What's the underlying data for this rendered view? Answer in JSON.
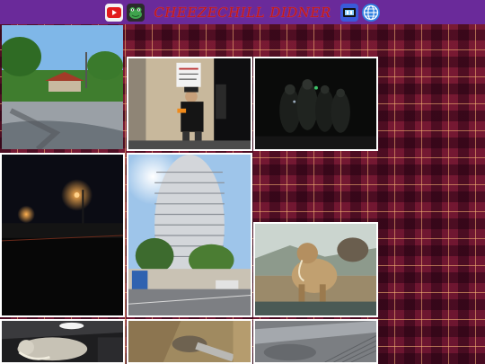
{
  "header": {
    "title": "CHEEZECHILL DIDNER",
    "icons": [
      "youtube-icon",
      "frog-icon",
      "tv-icon",
      "globe-icon"
    ]
  },
  "gallery": {
    "photos": [
      "park-gazebo-photo",
      "night-sign-person-photo",
      "dark-figures-photo",
      "night-street-photo",
      "round-tower-photo",
      "mammoth-diorama-photo",
      "mammoth-skeleton-photo",
      "rock-closeup-photo",
      "metal-surface-photo"
    ]
  },
  "colors": {
    "topbar": "#6a2a9a",
    "plaid_base": "#6b1530",
    "title_red": "#c01818"
  }
}
